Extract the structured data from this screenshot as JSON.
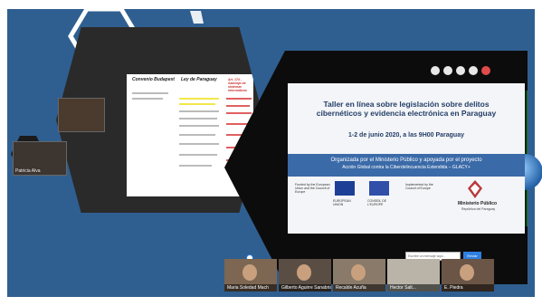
{
  "colors": {
    "background": "#2f5f90",
    "panel_dark": "#0c0c0c",
    "slide_title": "#243e66",
    "band": "#3b6aa8",
    "leave_icon": "#e14b4b"
  },
  "left_document": {
    "col1_heading": "Convenio Budapest",
    "col2_heading": "Ley de Paraguay",
    "col3_heading": "Art. 174 - Sabotaje de sistemas informáticos"
  },
  "left_cameras": [
    {
      "name": ""
    },
    {
      "name": "Patricia Alva"
    }
  ],
  "slide": {
    "title": "Taller en línea sobre legislación sobre delitos cibernéticos y evidencia electrónica en Paraguay",
    "date": "1-2 de junio 2020,  a las 9H00 Paraguay",
    "band_line1": "Organizada por el Ministerio Público y apoyada por el proyecto",
    "band_line2": "Acción Global contra la Ciberdelincuencia Extendida – GLACY+",
    "funded_text": "Funded by the European Union and the Council of Europe",
    "implemented_text": "Implemented by the Council of Europe",
    "eu_caption": "EUROPEAN UNION",
    "coe_caption": "CONSEIL DE L'EUROPE",
    "mp_name": "Ministerio Público",
    "mp_sub": "República del Paraguay"
  },
  "chat": {
    "placeholder": "Escribe un mensaje aquí...",
    "send_label": "Enviar"
  },
  "participants": [
    {
      "name": "Maria Soledad Mach"
    },
    {
      "name": "Gilberto Aguirre Sanabria"
    },
    {
      "name": "Recalde Acuña"
    },
    {
      "name": "Hector Salt..."
    },
    {
      "name": "E. Piedra"
    }
  ],
  "top_icons": [
    "chat-icon",
    "people-icon",
    "mic-icon",
    "camera-icon",
    "leave-icon"
  ]
}
